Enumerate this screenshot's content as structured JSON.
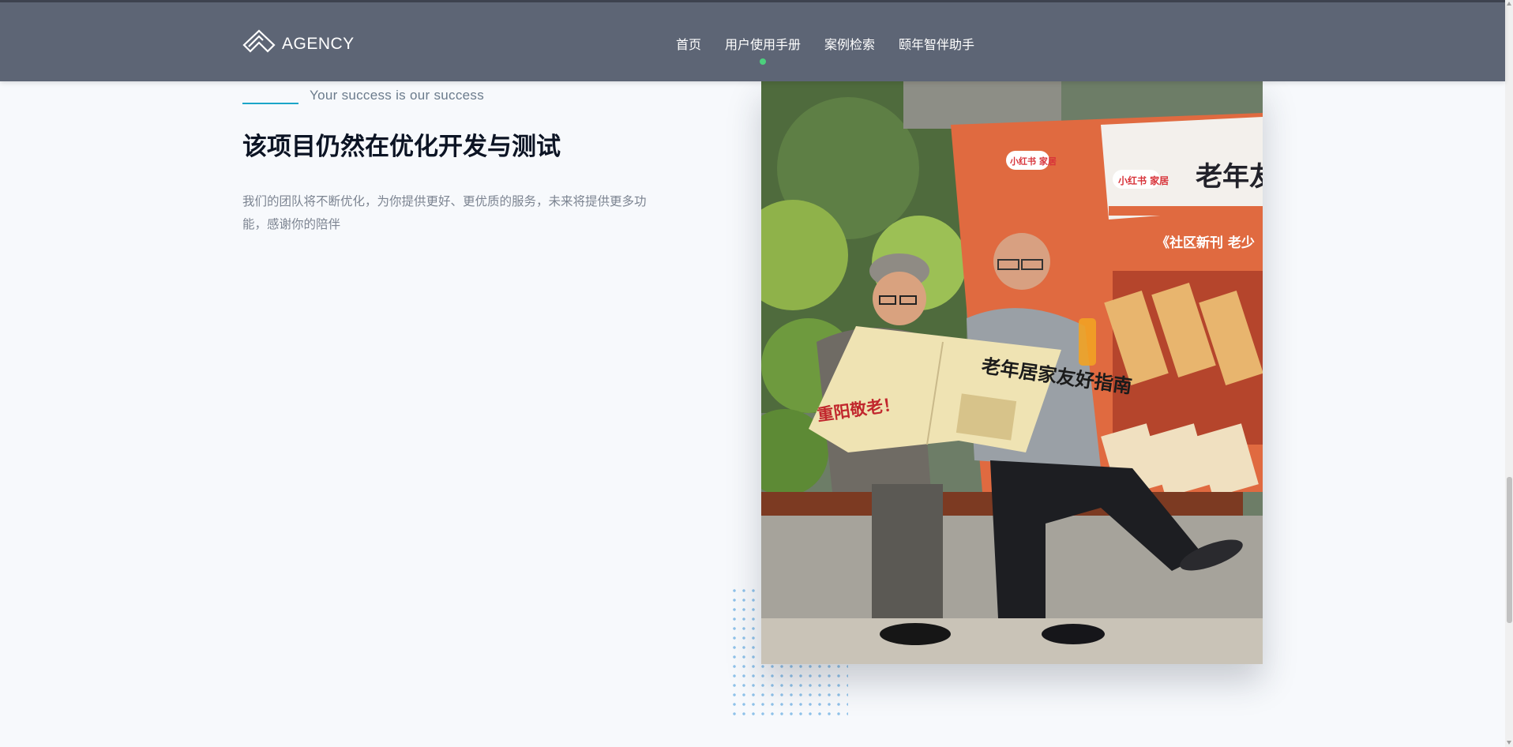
{
  "brand": {
    "name": "AGENCY",
    "logo_icon": "diamond-logo-icon"
  },
  "nav": {
    "items": [
      {
        "label": "首页",
        "active": false
      },
      {
        "label": "用户使用手册",
        "active": true
      },
      {
        "label": "案例检索",
        "active": false
      },
      {
        "label": "颐年智伴助手",
        "active": false
      }
    ]
  },
  "hero": {
    "tagline": "Your success is our success",
    "title": "该项目仍然在优化开发与测试",
    "description": "我们的团队将不断优化，为你提供更好、更优质的服务，未来将提供更多功能，感谢你的陪伴"
  },
  "photo": {
    "subject": "two elderly men reading a newspaper on a bench",
    "banner_text": "老年友",
    "brand_badges": [
      "小红书 家居",
      "小红书 家居"
    ],
    "subtitle_text": "《社区新刊 老少",
    "newspaper_headline": "老年居家友好指南",
    "newspaper_side": "重阳敬老！"
  },
  "colors": {
    "navbar": "#5d6575",
    "background": "#f7f9fc",
    "accent_line": "#1ba6c8",
    "active_dot": "#4cd07d",
    "headline": "#0c1424"
  }
}
